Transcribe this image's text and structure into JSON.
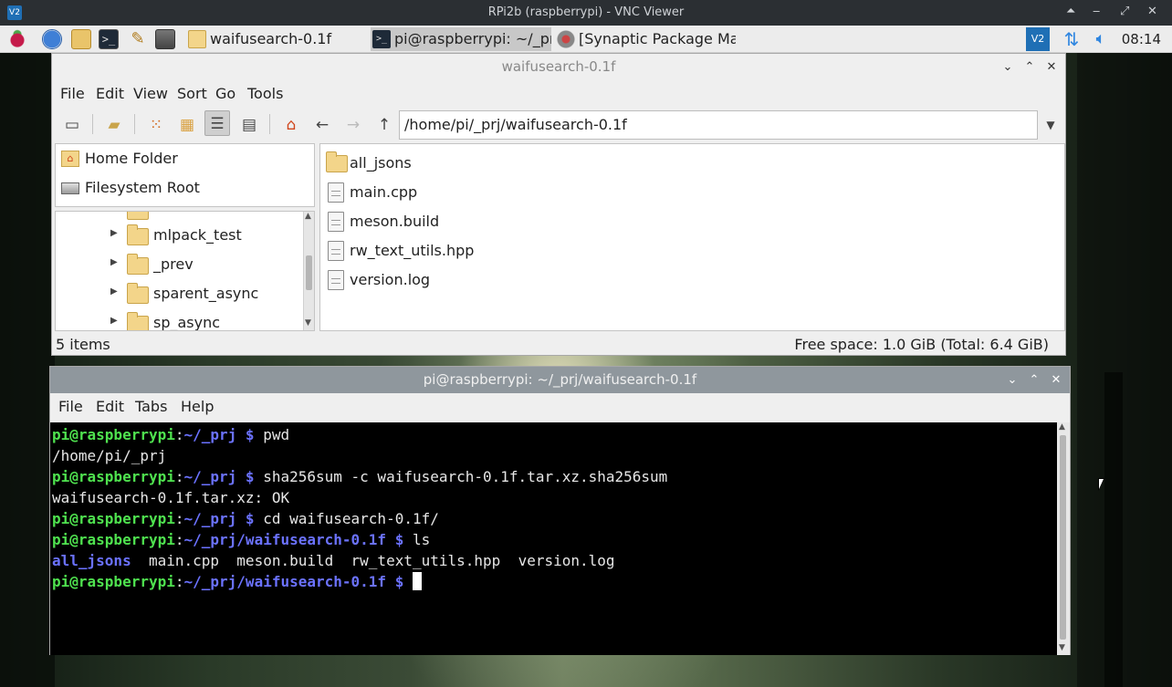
{
  "vnc": {
    "title": "RPi2b (raspberrypi) - VNC Viewer",
    "logo": "V2"
  },
  "panel": {
    "tasks": [
      {
        "label": "waifusearch-0.1f",
        "icon": "folder-icon"
      },
      {
        "label": "pi@raspberrypi: ~/_prj...",
        "icon": "terminal-icon"
      },
      {
        "label": "[Synaptic Package Ma...",
        "icon": "synaptic-icon"
      }
    ],
    "tray_logo": "V2",
    "clock": "08:14"
  },
  "file_manager": {
    "title": "waifusearch-0.1f",
    "menu": [
      "File",
      "Edit",
      "View",
      "Sort",
      "Go",
      "Tools"
    ],
    "path": "/home/pi/_prj/waifusearch-0.1f",
    "places": [
      "Home Folder",
      "Filesystem Root"
    ],
    "tree_items": [
      "mlpack_test",
      "_prev",
      "sparent_async",
      "sp_async"
    ],
    "files": [
      {
        "name": "all_jsons",
        "type": "folder"
      },
      {
        "name": "main.cpp",
        "type": "file"
      },
      {
        "name": "meson.build",
        "type": "file"
      },
      {
        "name": "rw_text_utils.hpp",
        "type": "file"
      },
      {
        "name": "version.log",
        "type": "file"
      }
    ],
    "status_count": "5 items",
    "status_space": "Free space: 1.0 GiB (Total: 6.4 GiB)"
  },
  "terminal": {
    "title": "pi@raspberrypi: ~/_prj/waifusearch-0.1f",
    "menu": [
      "File",
      "Edit",
      "Tabs",
      "Help"
    ],
    "prompt_user": "pi@raspberrypi",
    "lines": [
      {
        "path": "~/_prj",
        "cmd": "pwd"
      },
      {
        "out": "/home/pi/_prj"
      },
      {
        "path": "~/_prj",
        "cmd": "sha256sum -c waifusearch-0.1f.tar.xz.sha256sum"
      },
      {
        "out": "waifusearch-0.1f.tar.xz: OK"
      },
      {
        "path": "~/_prj",
        "cmd": "cd waifusearch-0.1f/"
      },
      {
        "path": "~/_prj/waifusearch-0.1f",
        "cmd": "ls"
      },
      {
        "ls": [
          "all_jsons",
          "main.cpp",
          "meson.build",
          "rw_text_utils.hpp",
          "version.log"
        ]
      },
      {
        "path": "~/_prj/waifusearch-0.1f",
        "cmd": "",
        "cursor": true
      }
    ]
  },
  "colors": {
    "prompt_user": "#4fe24f",
    "prompt_path": "#6b72ff",
    "terminal_bg": "#000000"
  }
}
